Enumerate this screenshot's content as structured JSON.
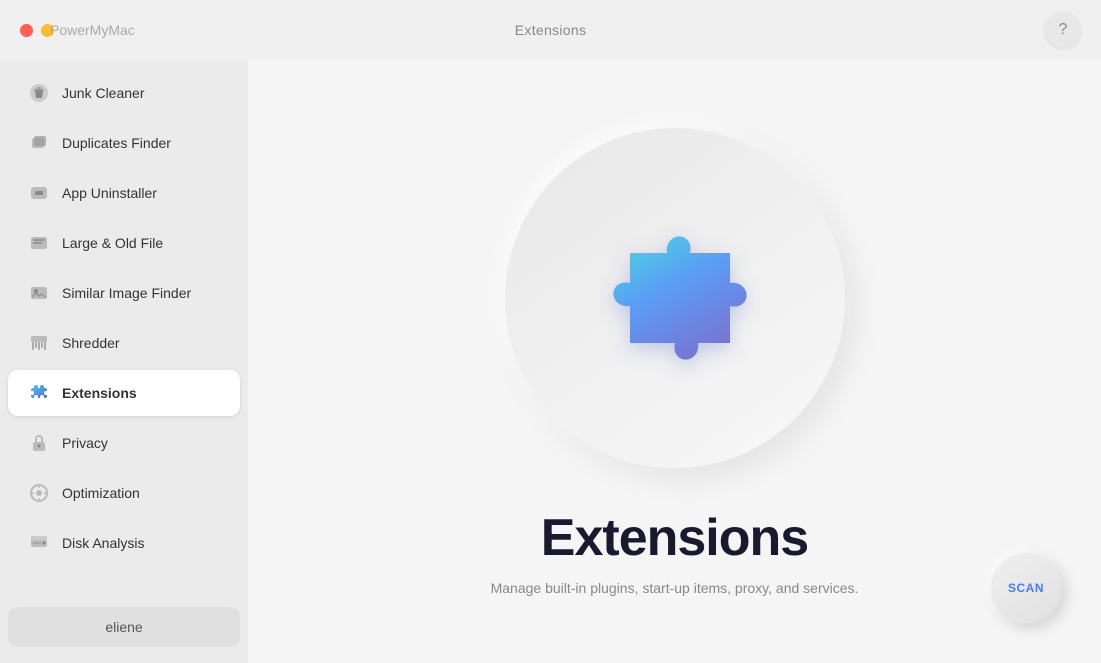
{
  "titlebar": {
    "brand": "PowerMyMac",
    "center_label": "Extensions",
    "help_label": "?"
  },
  "sidebar": {
    "items": [
      {
        "id": "junk-cleaner",
        "label": "Junk Cleaner",
        "icon": "🧹",
        "active": false
      },
      {
        "id": "duplicates-finder",
        "label": "Duplicates Finder",
        "icon": "📁",
        "active": false
      },
      {
        "id": "app-uninstaller",
        "label": "App Uninstaller",
        "icon": "🖥",
        "active": false
      },
      {
        "id": "large-old-file",
        "label": "Large & Old File",
        "icon": "💼",
        "active": false
      },
      {
        "id": "similar-image-finder",
        "label": "Similar Image Finder",
        "icon": "🖼",
        "active": false
      },
      {
        "id": "shredder",
        "label": "Shredder",
        "icon": "🗂",
        "active": false
      },
      {
        "id": "extensions",
        "label": "Extensions",
        "icon": "🧩",
        "active": true
      },
      {
        "id": "privacy",
        "label": "Privacy",
        "icon": "🔒",
        "active": false
      },
      {
        "id": "optimization",
        "label": "Optimization",
        "icon": "⚙",
        "active": false
      },
      {
        "id": "disk-analysis",
        "label": "Disk Analysis",
        "icon": "💾",
        "active": false
      }
    ],
    "user_label": "eliene"
  },
  "content": {
    "title": "Extensions",
    "subtitle": "Manage built-in plugins, start-up items, proxy, and services.",
    "scan_label": "SCAN"
  }
}
